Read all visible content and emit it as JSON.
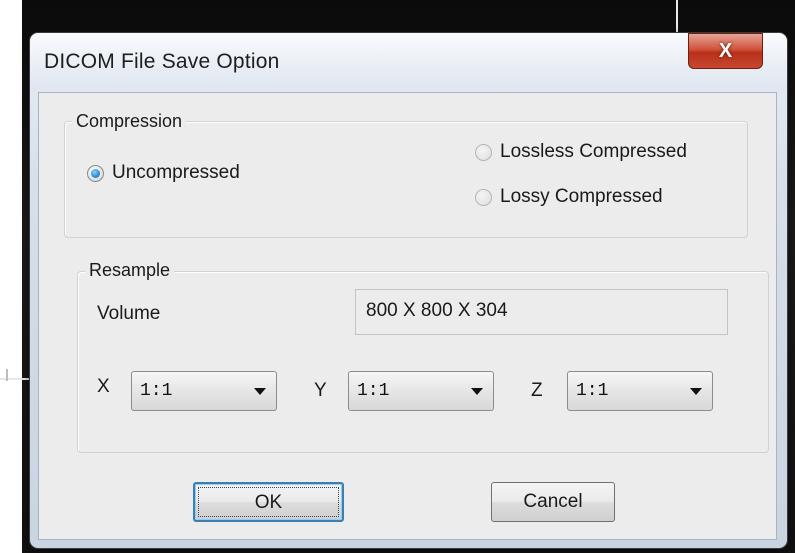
{
  "dialog": {
    "title": "DICOM File Save Option",
    "close_label": "X",
    "compression": {
      "group_label": "Compression",
      "options": [
        {
          "label": "Uncompressed",
          "selected": true,
          "enabled": true
        },
        {
          "label": "Lossless Compressed",
          "selected": false,
          "enabled": false
        },
        {
          "label": "Lossy Compressed",
          "selected": false,
          "enabled": false
        }
      ]
    },
    "resample": {
      "group_label": "Resample",
      "volume_label": "Volume",
      "volume_value": "800 X 800 X 304",
      "x_label": "X",
      "x_value": "1:1",
      "y_label": "Y",
      "y_value": "1:1",
      "z_label": "Z",
      "z_value": "1:1"
    },
    "ok_label": "OK",
    "cancel_label": "Cancel"
  },
  "colors": {
    "close_button": "#c8472f",
    "radio_selected": "#2a8ad6",
    "default_button_border": "#3c7fb1"
  }
}
